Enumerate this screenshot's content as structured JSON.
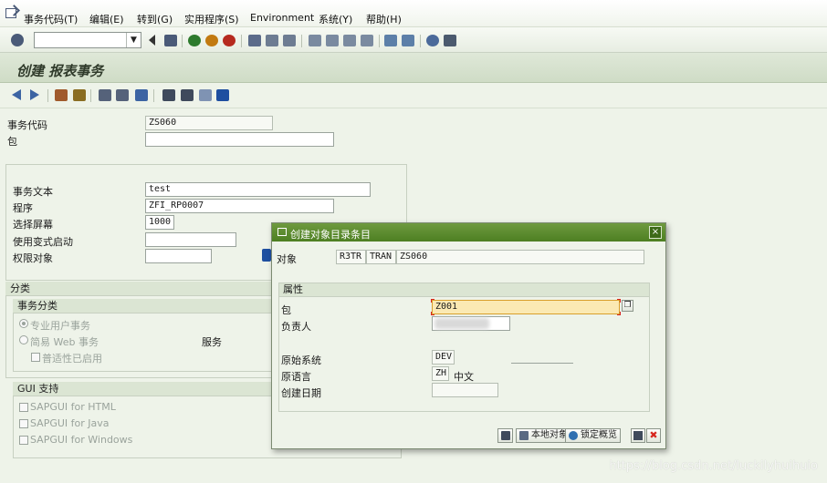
{
  "menubar": {
    "items": [
      "事务代码(T)",
      "编辑(E)",
      "转到(G)",
      "实用程序(S)",
      "Environment",
      "系统(Y)",
      "帮助(H)"
    ]
  },
  "toolbar": {
    "okcode_value": "",
    "okcode_dropdown": "▼"
  },
  "title": {
    "text": "创建 报表事务"
  },
  "form": {
    "tcode_label": "事务代码",
    "tcode_value": "ZS060",
    "package_label": "包",
    "package_value": "",
    "text_label": "事务文本",
    "text_value": "test",
    "program_label": "程序",
    "program_value": "ZFI_RP0007",
    "screen_label": "选择屏幕",
    "screen_value": "1000",
    "variant_label": "使用变式启动",
    "variant_value": "",
    "auth_label": "权限对象",
    "auth_value": ""
  },
  "classification": {
    "title": "分类",
    "subtitle": "事务分类",
    "radio_pro": "专业用户事务",
    "radio_web": "简易 Web 事务",
    "service_label": "服务",
    "pervasive": "普适性已启用"
  },
  "gui": {
    "title": "GUI 支持",
    "html": "SAPGUI for HTML",
    "java": "SAPGUI for Java",
    "windows": "SAPGUI for Windows"
  },
  "dialog": {
    "title": "创建对象目录条目",
    "close": "×",
    "object_label": "对象",
    "obj_pgmid": "R3TR",
    "obj_type": "TRAN",
    "obj_name": "ZS060",
    "attrs_title": "属性",
    "package_label": "包",
    "package_value": "Z001",
    "owner_label": "负责人",
    "owner_value": "",
    "srcsys_label": "原始系统",
    "srcsys_value": "DEV",
    "lang_label": "原语言",
    "lang_value": "ZH",
    "lang_name": "中文",
    "created_label": "创建日期",
    "created_value": "",
    "btn_local": "本地对象",
    "btn_lock": "锁定概览",
    "btn_cancel": "✖"
  },
  "watermark": "https://blog.csdn.net/luckilyhuihuio",
  "colors": {
    "accent_green": "#4d7f22",
    "focus_yellow": "#fbe9b3",
    "cancel_red": "#d7261f"
  }
}
